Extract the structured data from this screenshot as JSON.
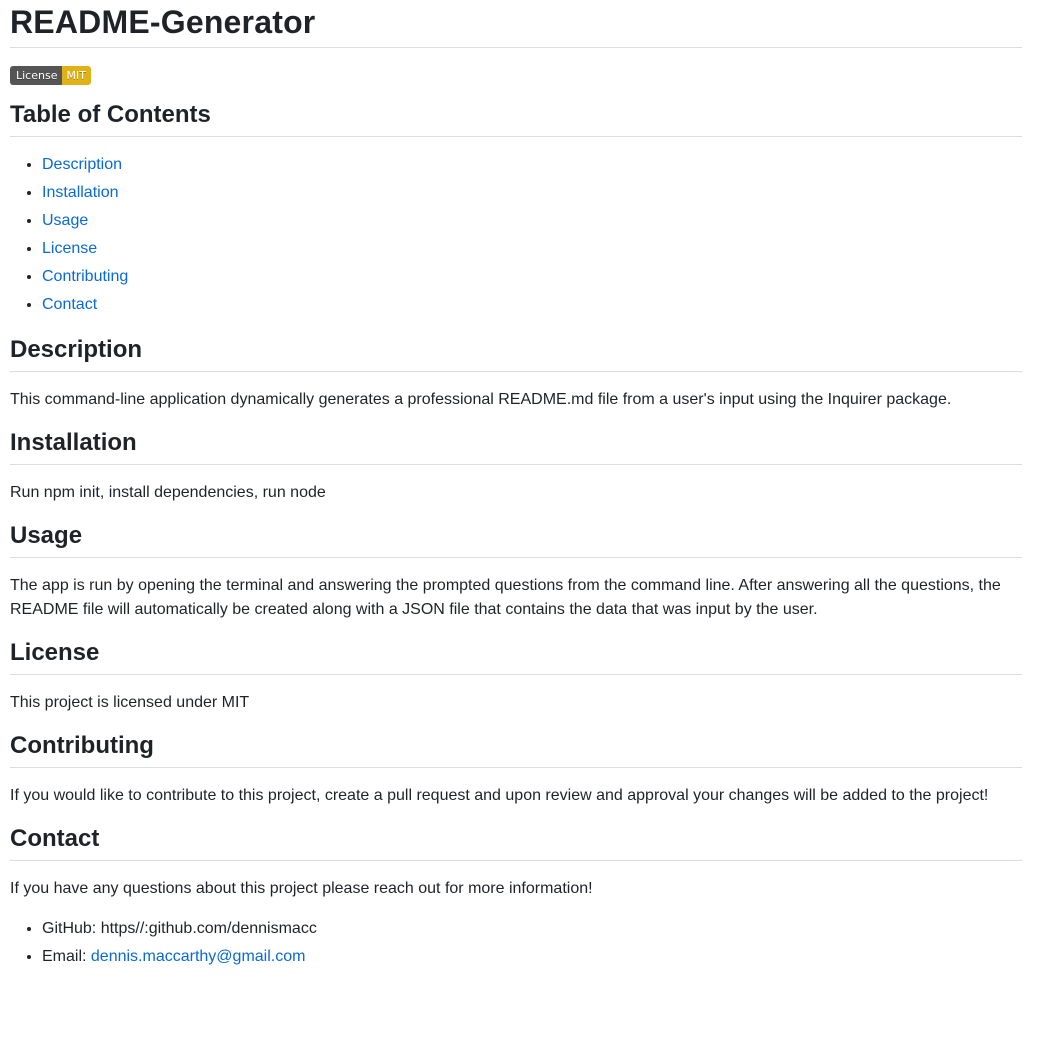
{
  "title": "README-Generator",
  "badge": {
    "left": "License",
    "right": "MIT",
    "right_color": "#dfb317"
  },
  "toc": {
    "heading": "Table of Contents",
    "items": [
      "Description",
      "Installation",
      "Usage",
      "License",
      "Contributing",
      "Contact"
    ]
  },
  "description": {
    "heading": "Description",
    "text": "This command-line application dynamically generates a professional README.md file from a user's input using the Inquirer package."
  },
  "installation": {
    "heading": "Installation",
    "text": "Run npm init, install dependencies, run node"
  },
  "usage": {
    "heading": "Usage",
    "text": "The app is run by opening the terminal and answering the prompted questions from the command line. After answering all the questions, the README file will automatically be created along with a JSON file that contains the data that was input by the user."
  },
  "license": {
    "heading": "License",
    "text": "This project is licensed under MIT"
  },
  "contributing": {
    "heading": "Contributing",
    "text": "If you would like to contribute to this project, create a pull request and upon review and approval your changes will be added to the project!"
  },
  "contact": {
    "heading": "Contact",
    "text": "If you have any questions about this project please reach out for more information!",
    "github_label": "GitHub:",
    "github_value": "https//:github.com/dennismacc",
    "email_label": "Email:",
    "email_value": "dennis.maccarthy@gmail.com"
  },
  "link_color": "#0969da"
}
